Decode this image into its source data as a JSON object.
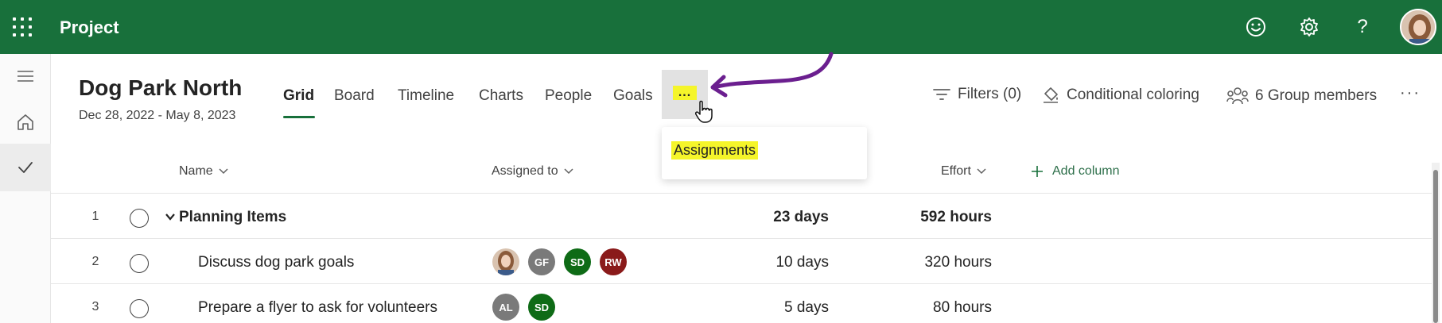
{
  "app": {
    "title": "Project"
  },
  "topbar": {
    "icons": [
      "smiley-icon",
      "settings-icon",
      "help-icon"
    ],
    "help_glyph": "?"
  },
  "plan": {
    "title": "Dog Park North",
    "dates": "Dec 28, 2022 - May 8, 2023"
  },
  "tabs": [
    {
      "label": "Grid",
      "active": true
    },
    {
      "label": "Board"
    },
    {
      "label": "Timeline"
    },
    {
      "label": "Charts"
    },
    {
      "label": "People"
    },
    {
      "label": "Goals"
    }
  ],
  "more_tab": {
    "label": "..."
  },
  "dropdown": {
    "items": [
      "Assignments"
    ]
  },
  "toolbar": {
    "filters": "Filters (0)",
    "conditional": "Conditional coloring",
    "group": "6 Group members",
    "more": "···"
  },
  "columns": {
    "name": "Name",
    "assigned": "Assigned to",
    "effort": "Effort",
    "add": "Add column"
  },
  "rows": [
    {
      "num": "1",
      "name": "Planning Items",
      "duration": "23 days",
      "effort": "592 hours",
      "summary": true,
      "assignees": []
    },
    {
      "num": "2",
      "name": "Discuss dog park goals",
      "duration": "10 days",
      "effort": "320 hours",
      "assignees": [
        "",
        "GF",
        "SD",
        "RW"
      ]
    },
    {
      "num": "3",
      "name": "Prepare a flyer to ask for volunteers",
      "duration": "5 days",
      "effort": "80 hours",
      "assignees": [
        "AL",
        "SD"
      ]
    }
  ],
  "colors": {
    "brand": "#18703b",
    "highlight": "#f5f52a",
    "arrow": "#6b1f8f",
    "gf": "#7a7a7a",
    "sd": "#0e6b16",
    "rw": "#8a1a1a",
    "al": "#7a7a7a"
  }
}
